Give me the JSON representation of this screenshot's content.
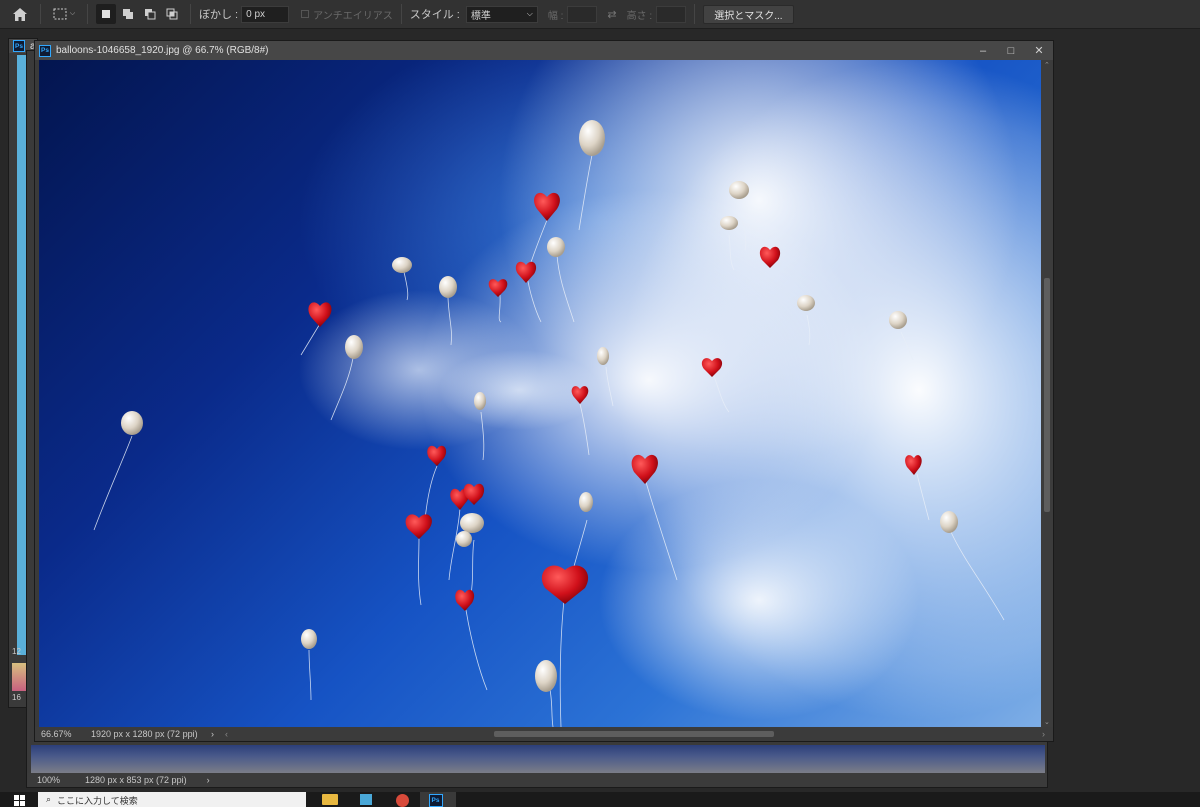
{
  "options_bar": {
    "feather_label": "ぼかし :",
    "feather_value": "0 px",
    "antialias_label": "アンチエイリアス",
    "style_label": "スタイル :",
    "style_value": "標準",
    "width_label": "幅 :",
    "height_label": "高さ :",
    "mask_button": "選択とマスク..."
  },
  "back_document": {
    "zoom": "100%",
    "dimensions": "1280 px x 853 px (72 ppi)",
    "partial_tab_1": "a",
    "partial_num_1": "12",
    "partial_num_2": "16"
  },
  "front_document": {
    "title": "balloons-1046658_1920.jpg @ 66.7% (RGB/8#)",
    "zoom": "66.67%",
    "dimensions": "1920 px x 1280 px (72 ppi)",
    "status_arrow": "›"
  },
  "window_controls": {
    "minimize": "–",
    "maximize": "□",
    "close": "✕"
  },
  "taskbar": {
    "search_placeholder": "ここに入力して検索"
  },
  "colors": {
    "app_bg": "#282828",
    "panel": "#323232",
    "accent": "#31a8ff"
  }
}
